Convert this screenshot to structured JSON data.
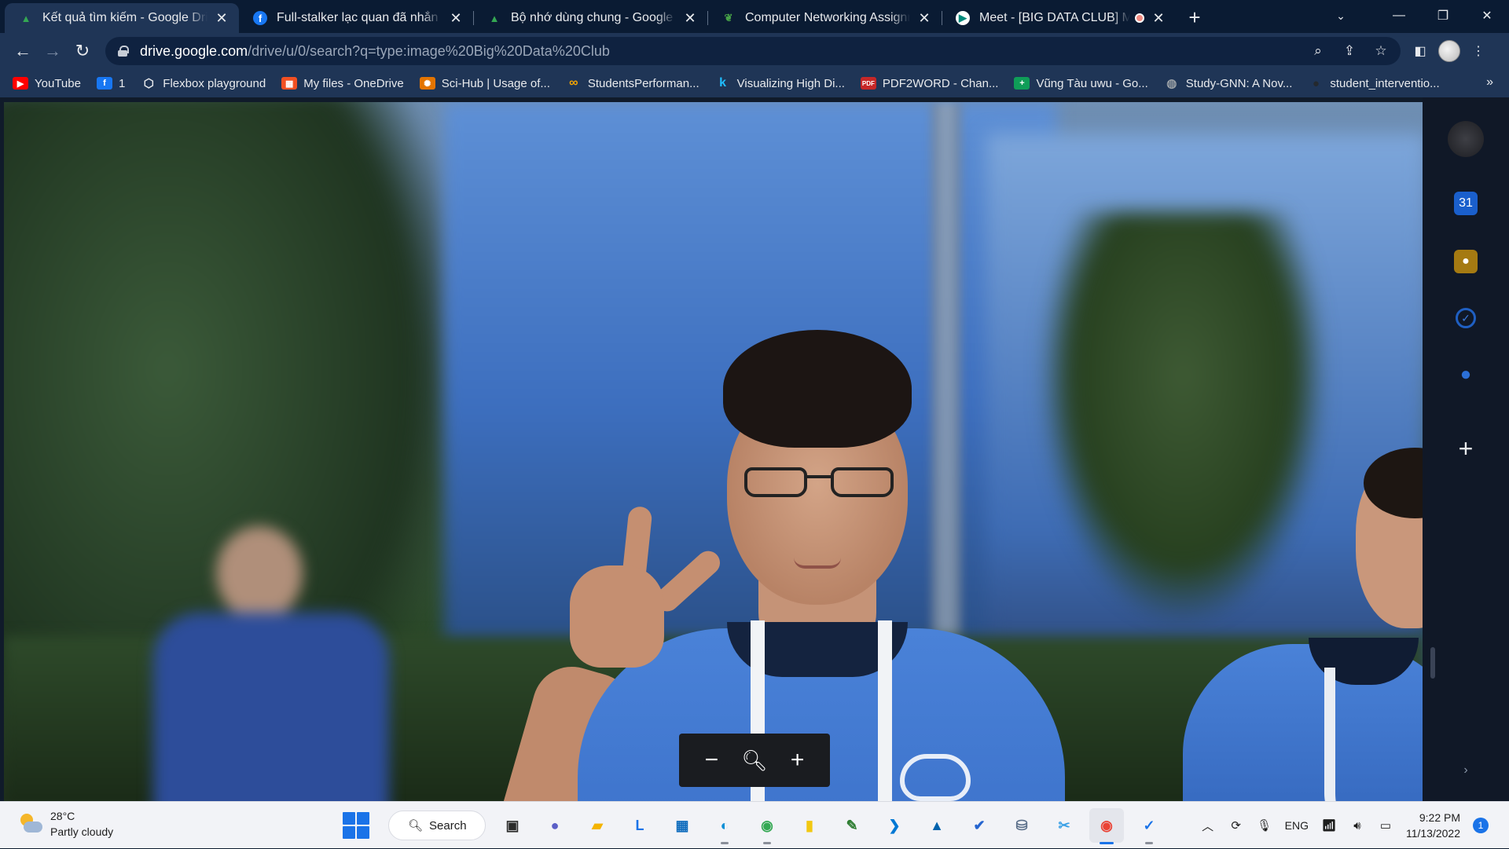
{
  "tabs": [
    {
      "title": "Kết quả tìm kiếm - Google Drive",
      "icon": "google-drive-icon",
      "active": true
    },
    {
      "title": "Full-stalker lạc quan đã nhắn tin",
      "icon": "facebook-icon",
      "active": false
    },
    {
      "title": "Bộ nhớ dùng chung - Google Drive",
      "icon": "google-drive-icon",
      "active": false
    },
    {
      "title": "Computer Networking Assignment",
      "icon": "leaf-icon",
      "active": false
    },
    {
      "title": "Meet - [BIG DATA CLUB] Meeting",
      "icon": "google-meet-icon",
      "active": false,
      "recording": true
    }
  ],
  "toolbar": {
    "url_host": "drive.google.com",
    "url_path": "/drive/u/0/search?q=type:image%20Big%20Data%20Club"
  },
  "bookmarks": [
    {
      "label": "YouTube",
      "icon": "youtube-icon",
      "color": "#ff0000"
    },
    {
      "label": "1",
      "icon": "facebook-icon",
      "color": "#1877f2"
    },
    {
      "label": "Flexbox playground",
      "icon": "flexbox-icon",
      "color": "#e8eaed"
    },
    {
      "label": "My files - OneDrive",
      "icon": "microsoft-icon",
      "color": "#f25022"
    },
    {
      "label": "Sci-Hub | Usage of...",
      "icon": "scihub-icon",
      "color": "#e37400"
    },
    {
      "label": "StudentsPerforman...",
      "icon": "infinity-icon",
      "color": "#f7a600"
    },
    {
      "label": "Visualizing High Di...",
      "icon": "k-icon",
      "color": "#20beff"
    },
    {
      "label": "PDF2WORD - Chan...",
      "icon": "pdf-icon",
      "color": "#c62828"
    },
    {
      "label": "Vũng Tàu uwu - Go...",
      "icon": "sheets-icon",
      "color": "#0f9d58"
    },
    {
      "label": "Study-GNN: A Nov...",
      "icon": "globe-icon",
      "color": "#9aa0a6"
    },
    {
      "label": "student_interventio...",
      "icon": "github-icon",
      "color": "#24292e"
    }
  ],
  "viewer": {
    "zoom_out": "−",
    "zoom_in": "+"
  },
  "taskbar": {
    "weather_temp": "28°C",
    "weather_desc": "Partly cloudy",
    "search_label": "Search",
    "lang": "ENG",
    "time": "9:22 PM",
    "date": "11/13/2022",
    "notifications": "1",
    "apps": [
      {
        "name": "task-view-icon",
        "glyph": "▣",
        "color": "#2b2b2b",
        "active": false,
        "running": false
      },
      {
        "name": "teams-chat-icon",
        "glyph": "●",
        "color": "#5b5fc7",
        "active": false,
        "running": false
      },
      {
        "name": "file-explorer-icon",
        "glyph": "▰",
        "color": "#f4b400",
        "active": false,
        "running": false
      },
      {
        "name": "l-app-icon",
        "glyph": "L",
        "color": "#1a73e8",
        "active": false,
        "running": false
      },
      {
        "name": "microsoft-store-icon",
        "glyph": "▦",
        "color": "#0f6cbd",
        "active": false,
        "running": false
      },
      {
        "name": "edge-icon",
        "glyph": "◐",
        "color": "#0b8fd6",
        "active": false,
        "running": true
      },
      {
        "name": "chrome-dev-icon",
        "glyph": "◉",
        "color": "#34a853",
        "active": false,
        "running": true
      },
      {
        "name": "power-bi-icon",
        "glyph": "▮",
        "color": "#f2c811",
        "active": false,
        "running": false
      },
      {
        "name": "paint-icon",
        "glyph": "✎",
        "color": "#2e7d32",
        "active": false,
        "running": false
      },
      {
        "name": "vscode-icon",
        "glyph": "❯",
        "color": "#0078d4",
        "active": false,
        "running": false
      },
      {
        "name": "azure-icon",
        "glyph": "▲",
        "color": "#0062ad",
        "active": false,
        "running": false
      },
      {
        "name": "todo-icon",
        "glyph": "✔",
        "color": "#2564cf",
        "active": false,
        "running": false
      },
      {
        "name": "ssms-icon",
        "glyph": "⛁",
        "color": "#5b6f8a",
        "active": false,
        "running": false
      },
      {
        "name": "snipping-tool-icon",
        "glyph": "✂",
        "color": "#3aa0e6",
        "active": false,
        "running": false
      },
      {
        "name": "chrome-icon",
        "glyph": "◉",
        "color": "#ea4335",
        "active": true,
        "running": true
      },
      {
        "name": "checklist-app-icon",
        "glyph": "✓",
        "color": "#1a73e8",
        "active": false,
        "running": true
      }
    ]
  }
}
